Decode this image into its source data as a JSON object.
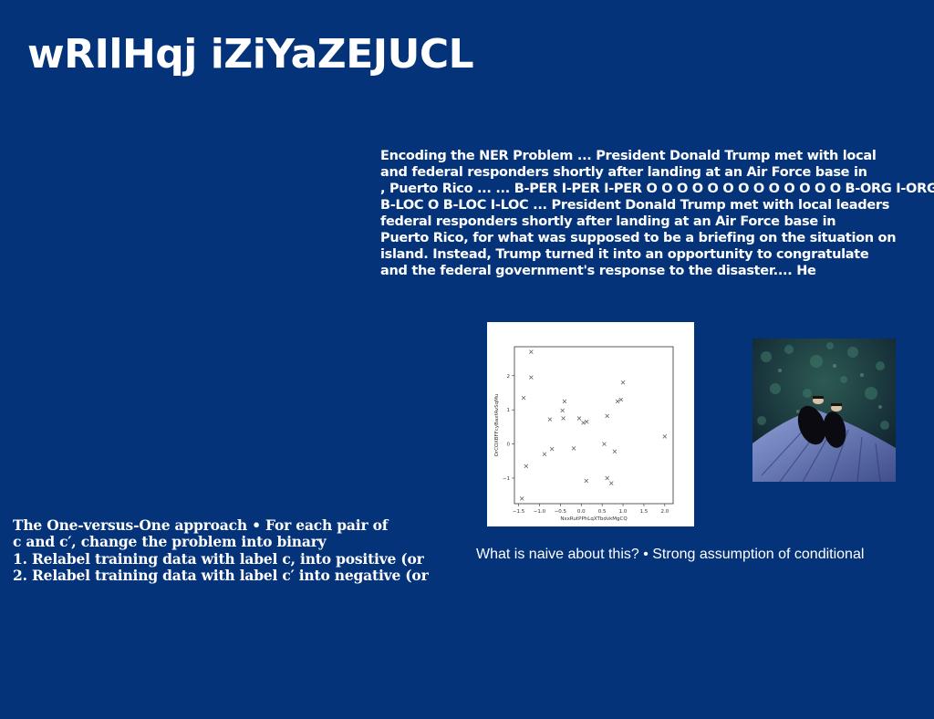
{
  "slide": {
    "title": "wRIlHqj iZiYaZEJUCL",
    "ner_lines": [
      "Encoding the NER Problem ... President Donald Trump met with local",
      "and federal responders shortly after landing at an Air Force base in",
      ", Puerto Rico ... ... B-PER I-PER I-PER O O O O O O O O O O O O O B-ORG I-ORG O",
      "B-LOC O B-LOC I-LOC ... President Donald Trump met with local leaders",
      "federal responders shortly after landing at an Air Force base in",
      "Puerto Rico, for what was supposed to be a briefing on the situation on",
      "island. Instead, Trump turned it into an opportunity to congratulate",
      "and the federal government's response to the disaster.... He"
    ],
    "ovo_lines": [
      "The One-versus-One approach • For each pair of",
      "c and c′, change the problem into binary",
      "1. Relabel training data with label c, into positive (or",
      "2. Relabel training data with label c′ into negative (or"
    ],
    "caption": "What is naive about this? • Strong assumption of conditional"
  },
  "chart_data": {
    "type": "scatter",
    "marker": "x",
    "marker_color": "#555555",
    "xlabel": "NxxRutPPhLqXTbdvkMgCQ",
    "ylabel": "OrCOXBFFcyBaxfAvSqMu",
    "xlim": [
      -1.6,
      2.2
    ],
    "ylim": [
      -1.75,
      2.85
    ],
    "xticks": [
      -1.5,
      -1.0,
      -0.5,
      0.0,
      0.5,
      1.0,
      1.5,
      2.0
    ],
    "xtick_labels": [
      "−1.5",
      "−1.0",
      "−0.5",
      "0.0",
      "0.5",
      "1.0",
      "1.5",
      "2.0"
    ],
    "yticks": [
      -1,
      0,
      1,
      2
    ],
    "ytick_labels": [
      "−1",
      "0",
      "1",
      "2"
    ],
    "points": [
      {
        "x": -1.2,
        "y": 2.7
      },
      {
        "x": -1.2,
        "y": 1.95
      },
      {
        "x": -1.38,
        "y": 1.35
      },
      {
        "x": -1.32,
        "y": -0.65
      },
      {
        "x": -1.42,
        "y": -1.6
      },
      {
        "x": -0.88,
        "y": -0.3
      },
      {
        "x": -0.7,
        "y": -0.15
      },
      {
        "x": -0.75,
        "y": 0.72
      },
      {
        "x": -0.45,
        "y": 0.98
      },
      {
        "x": -0.43,
        "y": 0.75
      },
      {
        "x": -0.4,
        "y": 1.25
      },
      {
        "x": -0.18,
        "y": -0.13
      },
      {
        "x": -0.05,
        "y": 0.75
      },
      {
        "x": 0.05,
        "y": 0.62
      },
      {
        "x": 0.13,
        "y": 0.65
      },
      {
        "x": 0.12,
        "y": -1.08
      },
      {
        "x": 0.55,
        "y": 0.0
      },
      {
        "x": 0.62,
        "y": 0.82
      },
      {
        "x": 0.62,
        "y": -1.0
      },
      {
        "x": 0.72,
        "y": -1.15
      },
      {
        "x": 0.8,
        "y": -0.22
      },
      {
        "x": 0.87,
        "y": 1.25
      },
      {
        "x": 0.95,
        "y": 1.3
      },
      {
        "x": 1.0,
        "y": 1.8
      },
      {
        "x": 2.0,
        "y": 0.22
      }
    ]
  },
  "photo": {
    "description_icon": "person-on-blanket-photo"
  }
}
